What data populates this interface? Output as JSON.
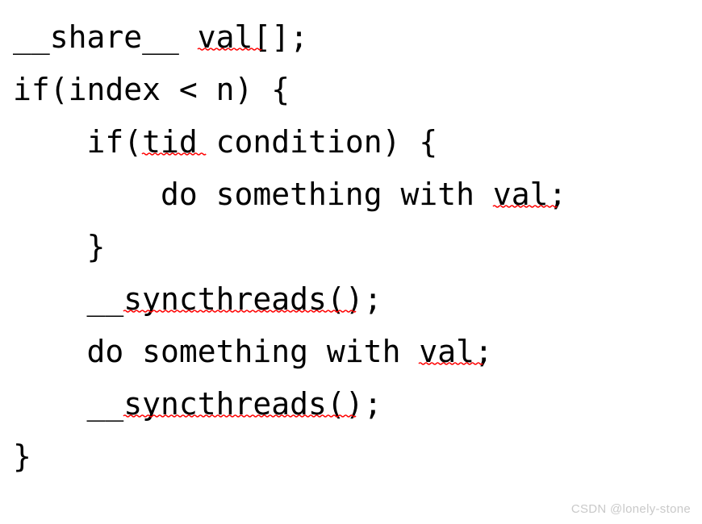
{
  "page": {
    "background_color": "#ffffff",
    "text_color": "#000000",
    "spellcheck_underline_color": "#ff0000",
    "watermark_color": "#c9c9c9"
  },
  "code": {
    "language": "cuda-c",
    "lines": [
      {
        "indent": 0,
        "segments": [
          {
            "text": "__share__ ",
            "misspelled": false
          },
          {
            "text": "val",
            "misspelled": true
          },
          {
            "text": "[];",
            "misspelled": false
          }
        ]
      },
      {
        "indent": 0,
        "segments": [
          {
            "text": "if(index < n) {",
            "misspelled": false
          }
        ]
      },
      {
        "indent": 4,
        "segments": [
          {
            "text": "if(",
            "misspelled": false
          },
          {
            "text": "tid",
            "misspelled": true
          },
          {
            "text": " condition) {",
            "misspelled": false
          }
        ]
      },
      {
        "indent": 8,
        "segments": [
          {
            "text": "do something with ",
            "misspelled": false
          },
          {
            "text": "val",
            "misspelled": true
          },
          {
            "text": ";",
            "misspelled": false
          }
        ]
      },
      {
        "indent": 4,
        "segments": [
          {
            "text": "}",
            "misspelled": false
          }
        ]
      },
      {
        "indent": 4,
        "segments": [
          {
            "text": "__",
            "misspelled": false
          },
          {
            "text": "syncthreads",
            "misspelled": true
          },
          {
            "text": "();",
            "misspelled": false
          }
        ]
      },
      {
        "indent": 4,
        "segments": [
          {
            "text": "do something with ",
            "misspelled": false
          },
          {
            "text": "val",
            "misspelled": true
          },
          {
            "text": ";",
            "misspelled": false
          }
        ]
      },
      {
        "indent": 4,
        "segments": [
          {
            "text": "__",
            "misspelled": false
          },
          {
            "text": "syncthreads",
            "misspelled": true
          },
          {
            "text": "();",
            "misspelled": false
          }
        ]
      },
      {
        "indent": 0,
        "segments": [
          {
            "text": "}",
            "misspelled": false
          }
        ]
      }
    ]
  },
  "watermark": {
    "text": "CSDN @lonely-stone"
  }
}
